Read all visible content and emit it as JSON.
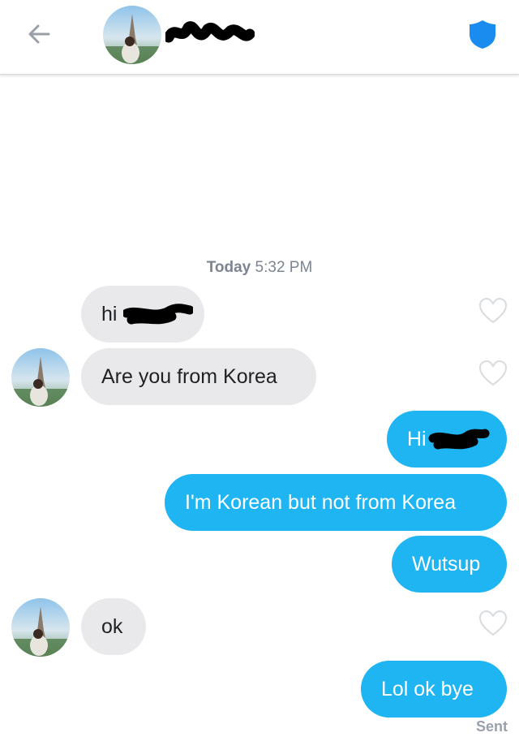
{
  "header": {
    "back_icon": "arrow-left-icon",
    "shield_icon": "shield-icon",
    "colors": {
      "shield": "#1a8cf0",
      "back": "#9aa0a6"
    }
  },
  "timestamp": {
    "day": "Today",
    "time": "5:32 PM"
  },
  "messages": [
    {
      "from": "them",
      "text": "hi",
      "redacted": true
    },
    {
      "from": "them",
      "text": "Are you from Korea"
    },
    {
      "from": "me",
      "text": "Hi",
      "redacted": true
    },
    {
      "from": "me",
      "text": "I'm Korean but not from Korea"
    },
    {
      "from": "me",
      "text": "Wutsup"
    },
    {
      "from": "them",
      "text": "ok"
    },
    {
      "from": "me",
      "text": "Lol ok bye"
    }
  ],
  "status": {
    "sent": "Sent"
  },
  "colors": {
    "incoming_bubble": "#e9e9ec",
    "outgoing_bubble": "#1fb4f2",
    "like_outline": "#d9dcdf",
    "redaction": "#000000"
  }
}
